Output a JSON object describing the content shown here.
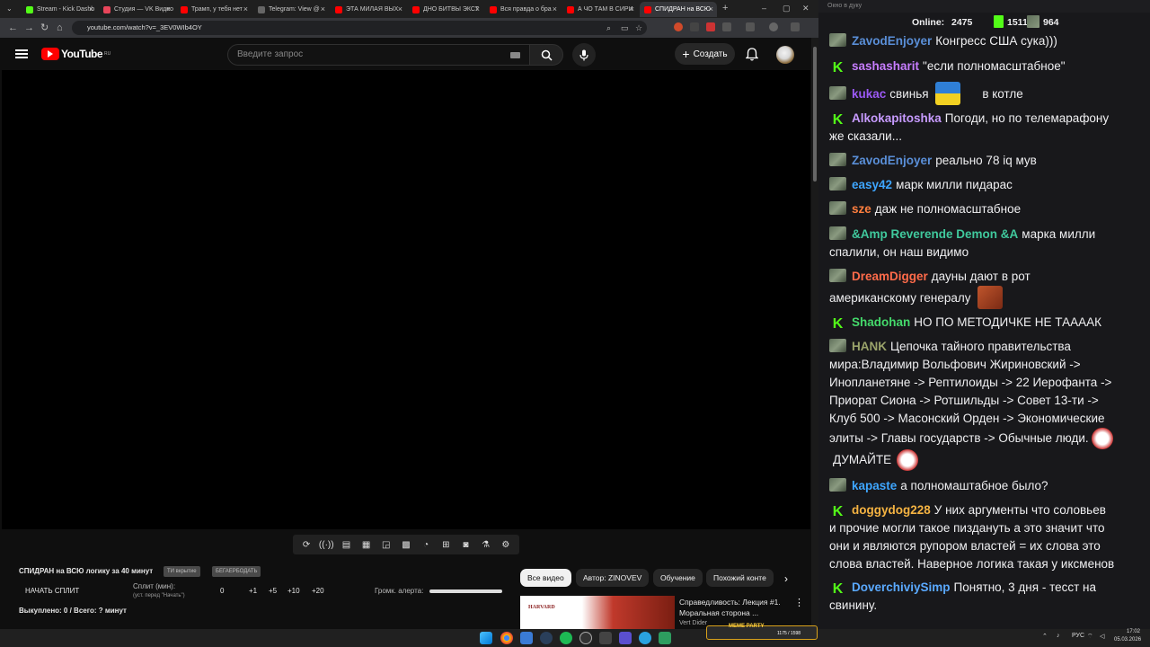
{
  "browser": {
    "tabs": [
      {
        "label": "Stream - Kick Dashb",
        "color": "#53fc18"
      },
      {
        "label": "Студия — VK Видео",
        "color": "#e8455a"
      },
      {
        "label": "Трамп, у тебя нет",
        "color": "#ff0000"
      },
      {
        "label": "Telegram: View @",
        "color": "#555"
      },
      {
        "label": "ЭТА МИЛАЯ ВЫХ",
        "color": "#ff0000"
      },
      {
        "label": "ДНО БИТВЫ ЭКСТ",
        "color": "#ff0000"
      },
      {
        "label": "Вся правда о бра",
        "color": "#ff0000"
      },
      {
        "label": "А ЧО ТАМ В СИРИ",
        "color": "#ff0000"
      },
      {
        "label": "СПИДРАН на ВСЮ",
        "color": "#ff0000"
      }
    ],
    "url": "youtube.com/watch?v=_3EV0WIb4OY"
  },
  "youtube": {
    "logo_text": "YouTube",
    "logo_region": "RU",
    "search_placeholder": "Введите запрос",
    "create_label": "Создать"
  },
  "overlay": {
    "title": "СПИДРАН на ВСЮ логику за 40 минут",
    "tag1": "ТИ вкрытие",
    "tag2": "БЕГАЕРБОДАТЬ",
    "start_split": "НАЧАТЬ СПЛИТ",
    "split_label": "Сплит (мин):",
    "split_sub": "(уст. перед \"Начать\")",
    "split_values": [
      "0",
      "+1",
      "+5",
      "+10",
      "+20"
    ],
    "volume_label": "Громк. алерта:",
    "paid_status": "Выкуплено: 0 / Всего: ? минут"
  },
  "chips": [
    "Все видео",
    "Автор: ZINOVEV",
    "Обучение",
    "Похожий конте"
  ],
  "recommended": {
    "title_line1": "Справедливость: Лекция #1.",
    "title_line2": "Моральная сторона ...",
    "channel": "Vert Dider",
    "thumb_label": "HARVARD"
  },
  "chat": {
    "window_title": "Окно в дуку",
    "online_label": "Online:",
    "online_value": "2475",
    "stat1": "1511",
    "stat2": "964",
    "messages": [
      {
        "user": "ZavodEnjoyer",
        "color": "#5a8fd8",
        "badge": "img",
        "text": "Конгресс США сука)))"
      },
      {
        "user": "sashasharit",
        "color": "#c77dff",
        "badge": "k",
        "text": "\"если полномасштабное\""
      },
      {
        "user": "kukac",
        "color": "#9b59f5",
        "badge": "img",
        "text": "свинья",
        "text2": "в котле"
      },
      {
        "user": "Alkokapitoshka",
        "color": "#c79bff",
        "badge": "k",
        "text": "Погоди, но по телемарафону",
        "line2": "же сказали..."
      },
      {
        "user": "ZavodEnjoyer",
        "color": "#5a8fd8",
        "badge": "img",
        "text": "реально 78 iq мув"
      },
      {
        "user": "easy42",
        "color": "#3ea6ff",
        "badge": "img",
        "text": "марк милли пидарас"
      },
      {
        "user": "sze",
        "color": "#ff7f3f",
        "badge": "img",
        "text": "даж не полномасштабное"
      },
      {
        "user": "&Amp Reverende Demon &A",
        "color": "#40c99d",
        "badge": "img",
        "text": "марка милли",
        "line2": "спалили, он наш видимо"
      },
      {
        "user": "DreamDigger",
        "color": "#ff6b4a",
        "badge": "img",
        "text": "дауны дают в рот",
        "line2": "американскому генералу"
      },
      {
        "user": "Shadohan",
        "color": "#44d96b",
        "badge": "k",
        "text": "НО ПО МЕТОДИЧКЕ НЕ ТААААК"
      },
      {
        "user": "HANK",
        "color": "#9aa36a",
        "badge": "img",
        "text": "Цепочка тайного правительства",
        "lines": [
          "мира:Владимир Вольфович Жириновский ->",
          "Инопланетяне -> Рептилоиды ->  22 Иерофанта ->",
          "Приорат Сиона -> Ротшильды -> Совет 13-ти ->",
          "Клуб 500 -> Масонский Орден -> Экономические",
          "элиты -> Главы государств -> Обычные люди.",
          "ДУМАЙТЕ"
        ]
      },
      {
        "user": "kapaste",
        "color": "#3ea6ff",
        "badge": "img",
        "text": "а полномаштабное было?"
      },
      {
        "user": "doggydog228",
        "color": "#f5b342",
        "badge": "k",
        "text": "У них аргументы что соловьев",
        "lines": [
          "и прочие могли такое пиздануть а это значит что",
          "они и являются рупором властей = их слова это",
          "слова властей. Наверное логика такая у иксменов"
        ]
      },
      {
        "user": "DoverchiviySimp",
        "color": "#5aa9ff",
        "badge": "k",
        "text": "Понятно, 3 дня - тесст на",
        "line2": "свинину."
      }
    ]
  },
  "taskbar": {
    "lang": "РУС",
    "time": "17:02",
    "date": "05.03.2026",
    "meme_label": "MEME PARTY",
    "meme_values": "1175 / 1598"
  }
}
